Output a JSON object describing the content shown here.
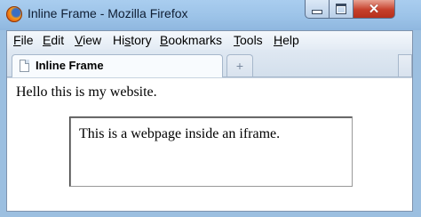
{
  "window": {
    "title": "Inline Frame - Mozilla Firefox"
  },
  "menu": [
    {
      "label_pre": "",
      "label_u": "F",
      "label_post": "ile"
    },
    {
      "label_pre": "",
      "label_u": "E",
      "label_post": "dit"
    },
    {
      "label_pre": "",
      "label_u": "V",
      "label_post": "iew"
    },
    {
      "label_pre": "Hi",
      "label_u": "s",
      "label_post": "tory"
    },
    {
      "label_pre": "",
      "label_u": "B",
      "label_post": "ookmarks"
    },
    {
      "label_pre": "",
      "label_u": "T",
      "label_post": "ools"
    },
    {
      "label_pre": "",
      "label_u": "H",
      "label_post": "elp"
    }
  ],
  "tabs": [
    {
      "label": "Inline Frame",
      "active": true
    }
  ],
  "new_tab_glyph": "+",
  "page": {
    "text": "Hello this is my website.",
    "iframe": {
      "text": "This is a webpage inside an iframe."
    }
  },
  "icons": {
    "app": "firefox-icon",
    "minimize": "minimize-icon",
    "maximize": "maximize-icon",
    "close": "close-icon",
    "page": "page-icon",
    "new_tab": "plus-icon"
  },
  "colors": {
    "titlebar": "#9cc3e8",
    "close_button": "#c6402b",
    "content_bg": "#ffffff"
  }
}
